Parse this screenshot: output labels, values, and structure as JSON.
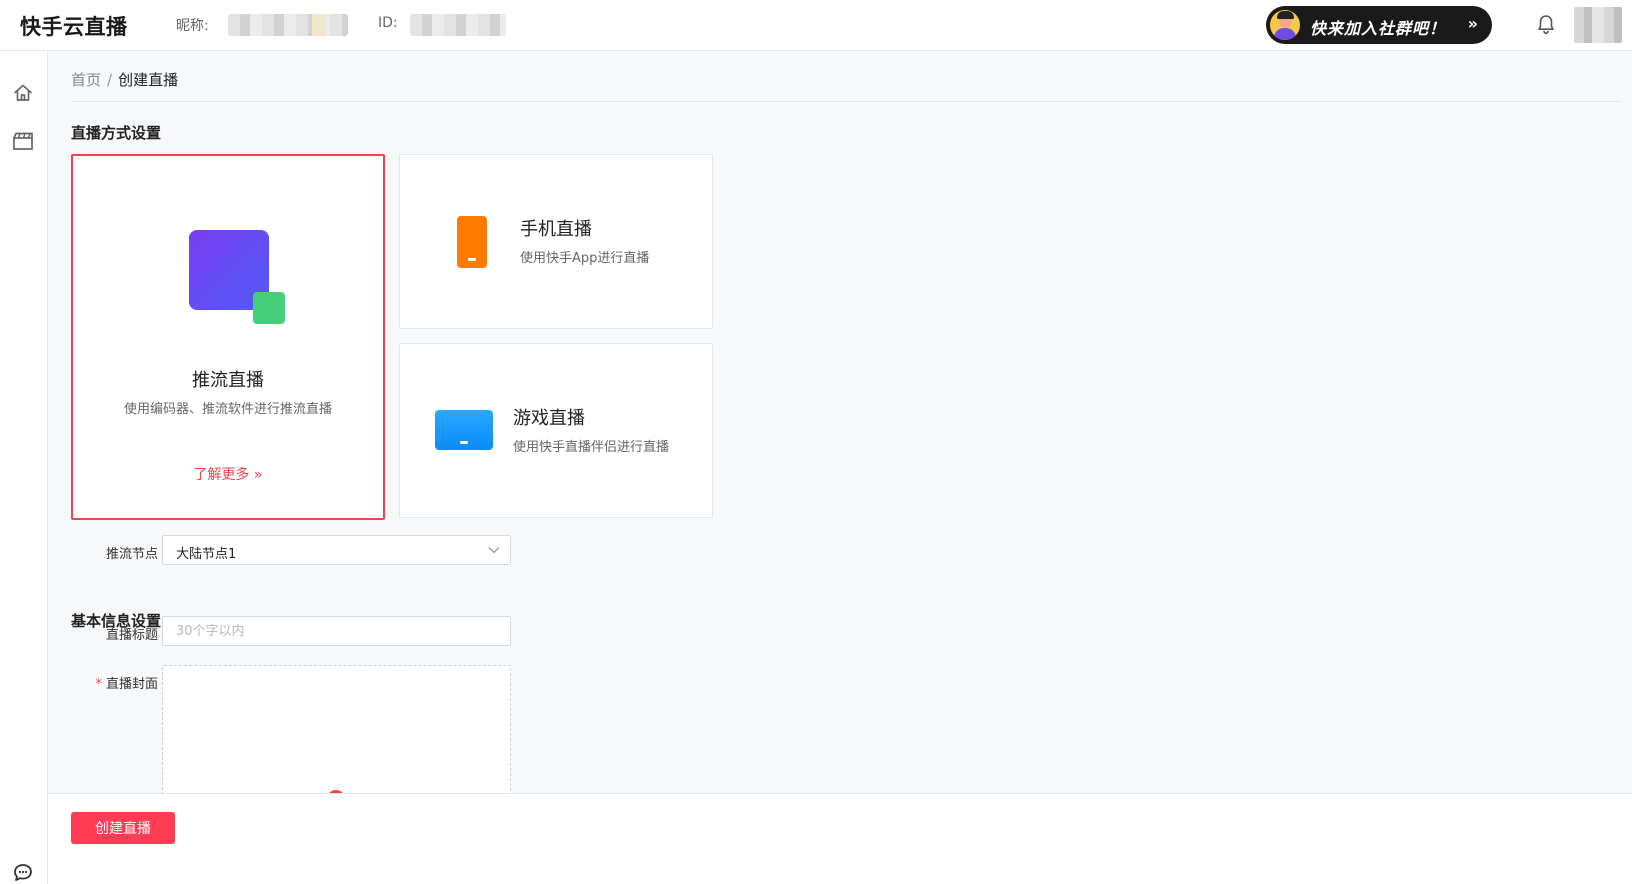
{
  "header": {
    "logo": "快手云直播",
    "nickname_label": "昵称:",
    "id_label": "ID:",
    "join_banner": "快来加入社群吧！",
    "join_arrow": "»"
  },
  "breadcrumb": {
    "home": "首页",
    "separator": "/",
    "current": "创建直播"
  },
  "mode_section": {
    "title": "直播方式设置",
    "options": [
      {
        "title": "推流直播",
        "desc": "使用编码器、推流软件进行推流直播",
        "more": "了解更多 »",
        "selected": true
      },
      {
        "title": "手机直播",
        "desc": "使用快手App进行直播",
        "selected": false
      },
      {
        "title": "游戏直播",
        "desc": "使用快手直播伴侣进行直播",
        "selected": false
      }
    ]
  },
  "push_node": {
    "label": "推流节点",
    "value": "大陆节点1"
  },
  "basic_section": {
    "title": "基本信息设置",
    "title_label": "直播标题",
    "title_placeholder": "30个字以内",
    "cover_label": "直播封面",
    "cover_required": "*"
  },
  "footer": {
    "create_button": "创建直播"
  },
  "colors": {
    "accent": "#fe3d54",
    "selected_border": "#f0434e",
    "phone_icon": "#ff7a00",
    "game_icon": "#0a8cf5",
    "push_icon_gradient_start": "#7a3df0",
    "push_icon_gradient_end": "#4f5cf5",
    "push_icon_secondary": "#46cf7a"
  },
  "icons": {
    "sidebar_home": "home-icon",
    "sidebar_video": "video-clapper-icon",
    "sidebar_chat": "chat-icon",
    "header_bell": "bell-icon"
  }
}
